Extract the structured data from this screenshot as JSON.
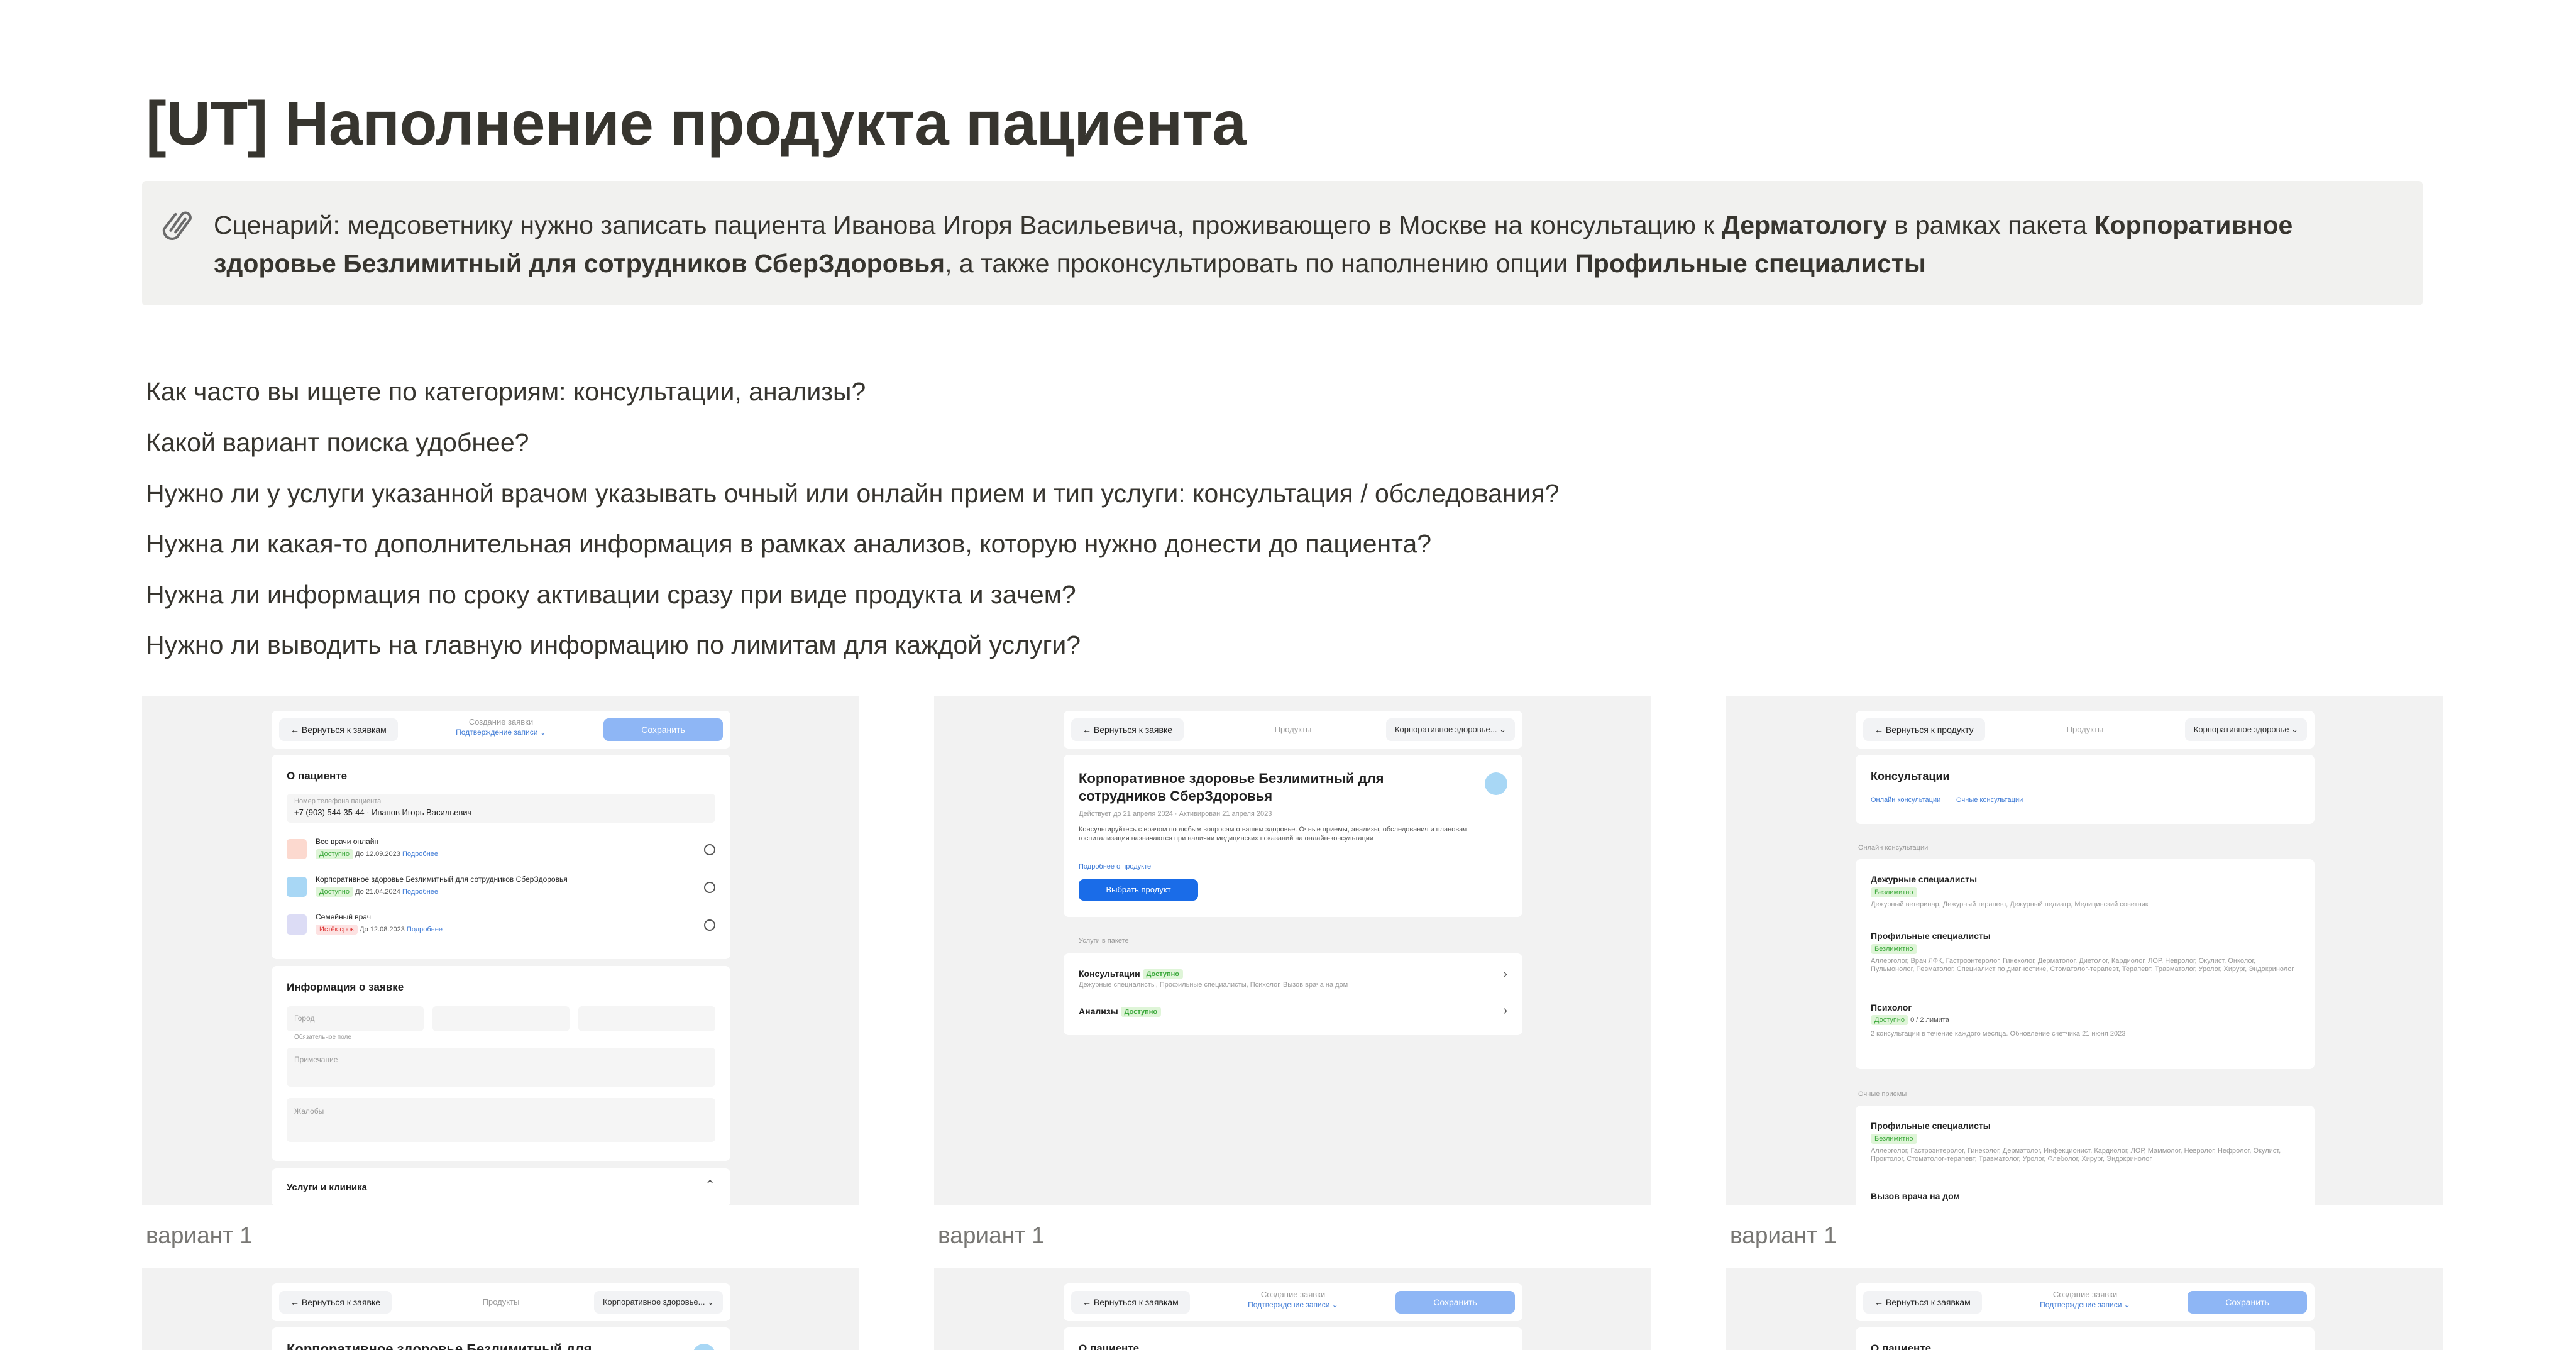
{
  "page": {
    "title": "[UT] Наполнение продукта пациента",
    "callout": {
      "icon": "paperclip-icon",
      "p1": "Сценарий: медсоветнику нужно записать пациента Иванова Игоря Васильевича, проживающего в Москве на консультацию к ",
      "b1": "Дерматологу",
      "p2": " в рамках пакета ",
      "b2": "Корпоративное здоровье Безлимитный для сотрудников СберЗдоровья",
      "p3": ", а также проконсультировать по наполнению опции ",
      "b3": "Профильные специалисты"
    },
    "questions": [
      "Как часто вы ищете по категориям: консультации, анализы?",
      "Какой вариант поиска удобнее?",
      "Нужно ли у услуги указанной врачом указывать очный или онлайн прием и тип услуги: консультация / обследования?",
      "Нужна ли какая-то дополнительная информация в рамках анализов, которую нужно донести до пациента?",
      "Нужна ли информация по сроку активации сразу при виде продукта и зачем?",
      "Нужно ли выводить на главную информацию по лимитам для каждой услуги?"
    ],
    "captions": [
      "вариант 1",
      "вариант 1",
      "вариант 1"
    ]
  },
  "s1": {
    "back": "Вернуться к заявкам",
    "center1": "Создание заявки",
    "center2": "Подтверждение записи ⌄",
    "save": "Сохранить",
    "about": "О пациенте",
    "phone_lbl": "Номер телефона пациента",
    "phone_val": "+7 (903) 544-35-44 · Иванов Игорь Васильевич",
    "products": [
      {
        "name": "Все врачи онлайн",
        "status": "Доступно",
        "until": "До 12.09.2023",
        "more": "Подробнее"
      },
      {
        "name": "Корпоративное здоровье Безлимитный для сотрудников СберЗдоровья",
        "status": "Доступно",
        "until": "До 21.04.2024",
        "more": "Подробнее"
      },
      {
        "name": "Семейный врач",
        "status": "Истёк срок",
        "until": "До 12.08.2023",
        "more": "Подробнее"
      }
    ],
    "info": "Информация о заявке",
    "f_city": "Город",
    "f_req": "Обязательное поле",
    "f_note": "Примечание",
    "f_comp": "Жалобы",
    "services": "Услуги и клиника"
  },
  "s2": {
    "back": "Вернуться к заявке",
    "center": "Продукты",
    "dropdown": "Корпоративное здоровье... ⌄",
    "title": "Корпоративное здоровье Безлимитный для сотрудников СберЗдоровья",
    "meta": "Действует до 21 апреля 2024 · Активирован 21 апреля 2023",
    "desc": "Консультируйтесь с врачом по любым вопросам о вашем здоровье. Очные приемы, анализы, обследования и плановая госпитализация назначаются при наличии медицинских показаний на онлайн-консультации",
    "more": "Подробнее о продукте",
    "choose": "Выбрать продукт",
    "section": "Услуги в пакете",
    "rows": [
      {
        "name": "Консультации",
        "status": "Доступно",
        "sub": "Дежурные специалисты, Профильные специалисты, Психолог, Вызов врача на дом"
      },
      {
        "name": "Анализы",
        "status": "Доступно",
        "sub": ""
      }
    ]
  },
  "s3": {
    "back": "Вернуться к продукту",
    "center": "Продукты",
    "dropdown": "Корпоративное здоровье ⌄",
    "card_title": "Консультации",
    "tab1": "Онлайн консультации",
    "tab2": "Очные консультации",
    "sec_online": "Онлайн консультации",
    "sec_offline": "Очные приемы",
    "items": [
      {
        "name": "Дежурные специалисты",
        "status": "Безлимитно",
        "sub": "Дежурный ветеринар, Дежурный терапевт, Дежурный педиатр, Медицинский советник"
      },
      {
        "name": "Профильные специалисты",
        "status": "Безлимитно",
        "sub": "Аллерголог, Врач ЛФК, Гастроэнтеролог, Гинеколог, Дерматолог, Диетолог, Кардиолог, ЛОР, Невролог, Окулист, Онколог, Пульмонолог, Ревматолог, Специалист по диагностике, Стоматолог-терапевт, Терапевт, Травматолог, Уролог, Хирург, Эндокринолог"
      },
      {
        "name": "Психолог",
        "status": "Доступно",
        "count": "0 / 2 лимита",
        "sub": "2 консультации в течение каждого месяца. Обновление счетчика 21 июня 2023"
      }
    ],
    "offline_items": [
      {
        "name": "Профильные специалисты",
        "status": "Безлимитно",
        "sub": "Аллерголог, Гастроэнтеролог, Гинеколог, Дерматолог, Инфекционист, Кардиолог, ЛОР, Маммолог, Невролог, Нефролог, Окулист, Проктолог, Стоматолог-терапевт, Травматолог, Уролог, Флеболог, Хирург, Эндокринолог"
      },
      {
        "name": "Вызов врача на дом",
        "status": "",
        "sub": ""
      }
    ]
  },
  "row2": {
    "a_back": "Вернуться к заявке",
    "a_center": "Продукты",
    "a_dropdown": "Корпоративное здоровье... ⌄",
    "a_title": "Корпоративное здоровье Безлимитный для",
    "b_back": "Вернуться к заявкам",
    "b_center1": "Создание заявки",
    "b_center2": "Подтверждение записи ⌄",
    "b_save": "Сохранить",
    "b_about": "О пациенте"
  },
  "colors": {
    "accent": "#1a6ce8",
    "accent_light": "#8eb6f5",
    "callout_bg": "#f1f1ef",
    "shot_bg": "#f2f2f2",
    "ok_badge": "#3aa83a"
  }
}
